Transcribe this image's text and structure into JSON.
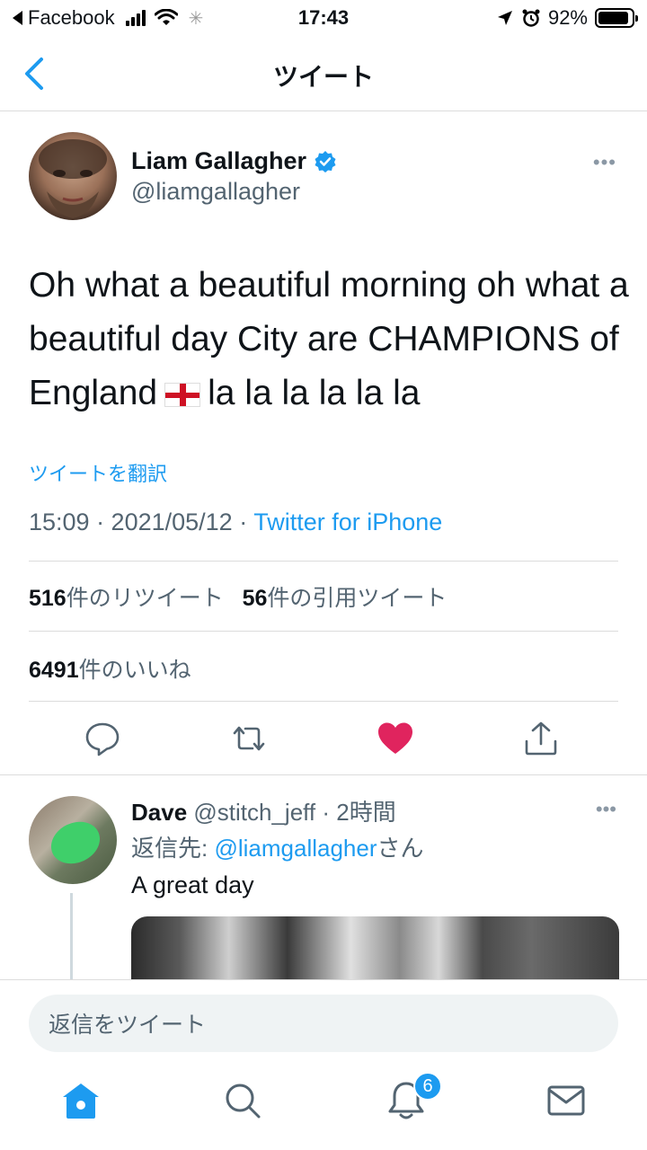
{
  "status_bar": {
    "back_app": "Facebook",
    "time": "17:43",
    "battery_percent_label": "92%",
    "battery_level": 0.92
  },
  "nav": {
    "title": "ツイート"
  },
  "tweet": {
    "author_name": "Liam Gallagher",
    "author_handle": "@liamgallagher",
    "text_before_flag": "Oh what a beautiful morning oh what a beautiful day City are CHAMPIONS of England",
    "text_after_flag": "la la la la la la",
    "translate_label": "ツイートを翻訳",
    "timestamp": "15:09 · 2021/05/12 · ",
    "source": "Twitter for iPhone",
    "retweet_count": "516",
    "retweet_label": "件のリツイート",
    "quote_count": "56",
    "quote_label": "件の引用ツイート",
    "like_count": "6491",
    "like_label": "件のいいね"
  },
  "reply": {
    "author_name": "Dave",
    "author_handle": "@stitch_jeff",
    "time": "· 2時間",
    "reply_to_prefix": "返信先: ",
    "reply_to_mention": "@liamgallagher",
    "reply_to_suffix": "さん",
    "text": "A great day"
  },
  "composer": {
    "placeholder": "返信をツイート"
  },
  "tab_bar": {
    "notification_count": "6"
  },
  "colors": {
    "accent": "#1d9bf0",
    "like": "#e0245e"
  },
  "icons": [
    "back-chevron-icon",
    "verified-badge-icon",
    "more-icon",
    "reply-icon",
    "retweet-icon",
    "heart-icon",
    "share-icon",
    "home-icon",
    "search-icon",
    "bell-icon",
    "mail-icon"
  ]
}
